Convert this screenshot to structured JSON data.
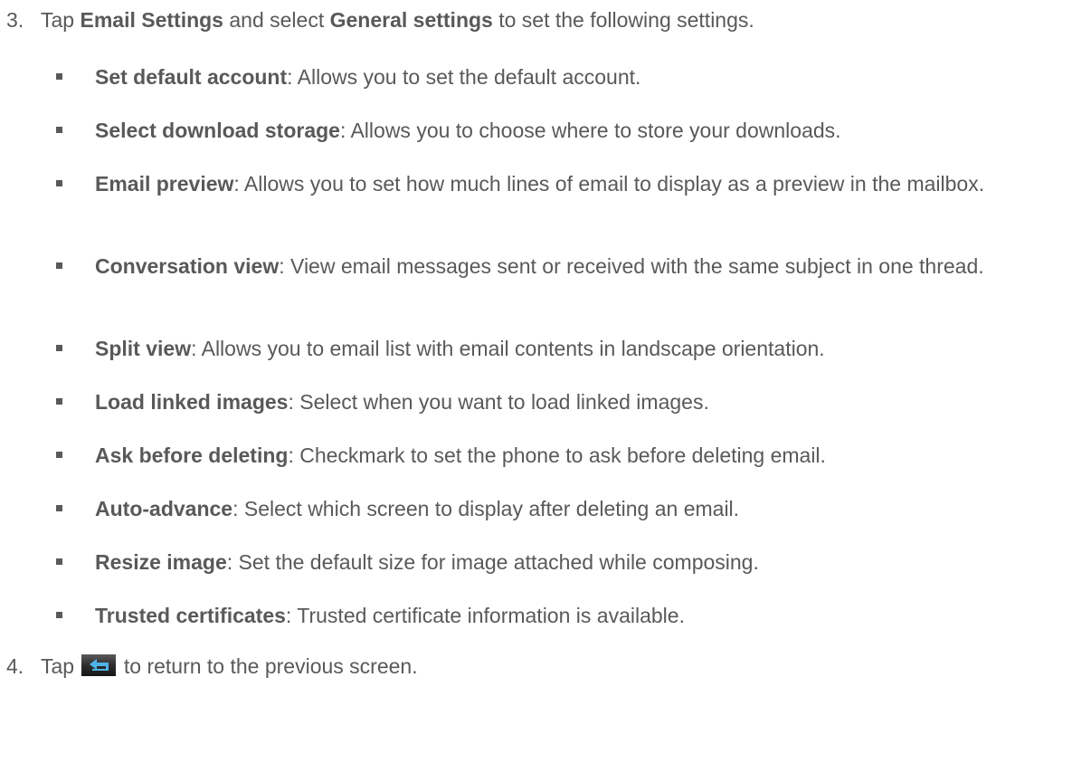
{
  "steps": [
    {
      "number": "3.",
      "text_before": "Tap ",
      "bold1": "Email Settings",
      "text_mid": " and select ",
      "bold2": "General settings",
      "text_after": " to set the following settings."
    },
    {
      "number": "4.",
      "text_before": "Tap",
      "icon": "back-key-icon",
      "text_after": "to return to the previous screen."
    }
  ],
  "settings": [
    {
      "term": "Set default account",
      "desc": ": Allows you to set the default account."
    },
    {
      "term": "Select download storage",
      "desc": ": Allows you to choose where to store your downloads."
    },
    {
      "term": "Email preview",
      "desc": ": Allows you to set how much lines of email to display as a preview in the mailbox."
    },
    {
      "term": "Conversation view",
      "desc": ": View email messages sent or received with the same subject in one thread."
    },
    {
      "term": "Split view",
      "desc": ": Allows you to email list with email contents in landscape orientation."
    },
    {
      "term": "Load linked images",
      "desc": ": Select when you want to load linked images."
    },
    {
      "term": "Ask before deleting",
      "desc": ": Checkmark to set the phone to ask before deleting email."
    },
    {
      "term": "Auto-advance",
      "desc": ": Select which screen to display after deleting an email."
    },
    {
      "term": "Resize image",
      "desc": ": Set the default size for image attached while composing."
    },
    {
      "term": "Trusted certificates",
      "desc": ": Trusted certificate information is available."
    }
  ]
}
